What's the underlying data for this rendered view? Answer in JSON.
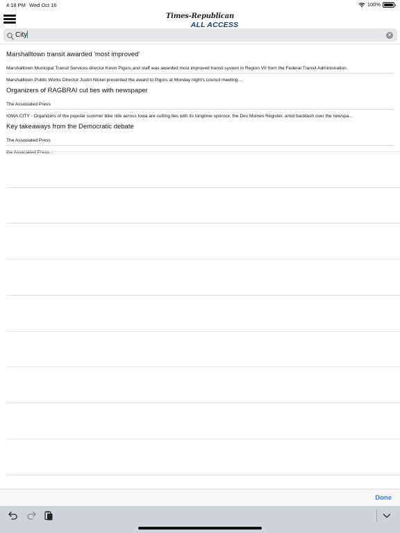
{
  "status_bar": {
    "time": "4:18 PM",
    "date": "Wed Oct 16",
    "battery": "100%",
    "battery_level": 1.0,
    "wifi_icon": "wifi-icon",
    "battery_icon": "battery-icon"
  },
  "header": {
    "menu_icon": "hamburger-menu-icon",
    "logo_top": "Times-Republican",
    "logo_bottom": "ALL ACCESS",
    "logo_color": "#1d3f6e"
  },
  "search": {
    "value": "City",
    "search_icon": "magnifier-icon",
    "clear_icon": "clear-x-icon"
  },
  "results": [
    {
      "title": "Marshalltown transit awarded 'most improved'",
      "snippet_lines": [
        "Marshalltown Municipal Transit Services director Kevin Pigors and staff was awarded most improved transit system in Region VII from the Federal Transit Administration.",
        "Marshalltown Public Works Director Justin Nickel presented the award to Pigors at Monday night's council meeting...."
      ]
    },
    {
      "title": "Organizers of RAGBRAI cut ties with newspaper",
      "snippet_lines": [
        "The Associated Press",
        "IOWA CITY - Organizers of the popular summer bike ride across Iowa are cutting ties with its longtime sponsor, the Des Moines Register, amid backlash over the newspa..."
      ]
    },
    {
      "title": "Key takeaways from the Democratic debate",
      "snippet_lines": [
        "The Associated Press",
        "the Associated Press..."
      ]
    }
  ],
  "done_bar": {
    "done_label": "Done",
    "accent_color": "#2f7de1"
  },
  "keyboard_bar": {
    "undo_icon": "undo-icon",
    "redo_icon": "redo-icon",
    "paste_icon": "clipboard-paste-icon",
    "dismiss_icon": "chevron-down-icon"
  }
}
